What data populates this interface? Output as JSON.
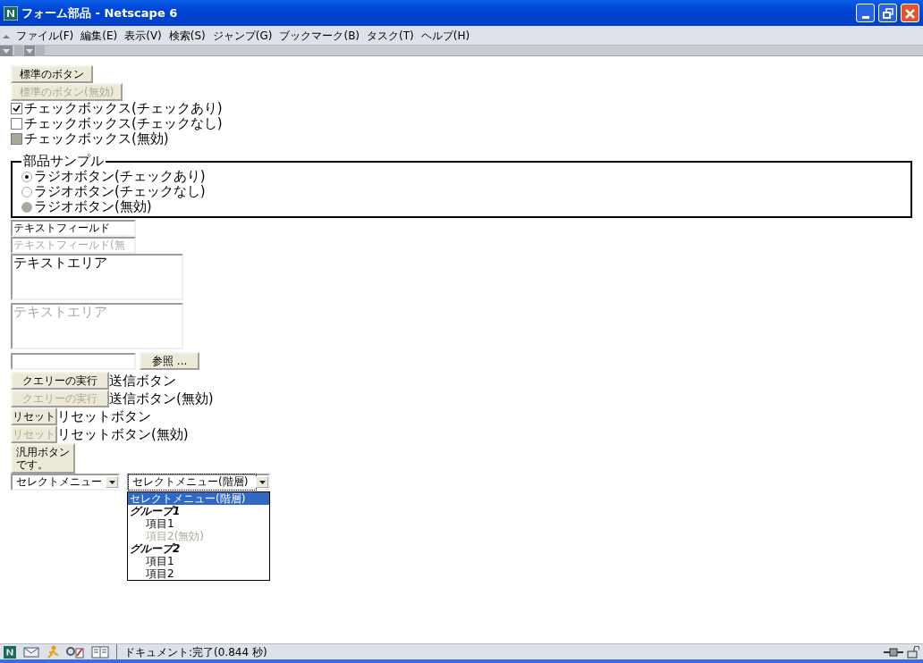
{
  "window": {
    "title": "フォーム部品 - Netscape 6"
  },
  "menu": [
    {
      "label": "ファイル(F)"
    },
    {
      "label": "編集(E)"
    },
    {
      "label": "表示(V)"
    },
    {
      "label": "検索(S)"
    },
    {
      "label": "ジャンプ(G)"
    },
    {
      "label": "ブックマーク(B)"
    },
    {
      "label": "タスク(T)"
    },
    {
      "label": "ヘルプ(H)"
    }
  ],
  "buttons": [
    {
      "label": "標準のボタン",
      "disabled": false
    },
    {
      "label": "標準のボタン(無効)",
      "disabled": true
    }
  ],
  "checkboxes": [
    {
      "label": "チェックボックス(チェックあり)",
      "checked": true,
      "disabled": false
    },
    {
      "label": "チェックボックス(チェックなし)",
      "checked": false,
      "disabled": false
    },
    {
      "label": "チェックボックス(無効)",
      "checked": false,
      "disabled": true
    }
  ],
  "radio_group": {
    "legend": "部品サンプル",
    "options": [
      {
        "label": "ラジオボタン(チェックあり)",
        "selected": true,
        "disabled": false
      },
      {
        "label": "ラジオボタン(チェックなし)",
        "selected": false,
        "disabled": false
      },
      {
        "label": "ラジオボタン(無効)",
        "selected": false,
        "disabled": true
      }
    ]
  },
  "text_fields": [
    {
      "value": "テキストフィールド",
      "disabled": false
    },
    {
      "value": "テキストフィールド(無",
      "disabled": true
    }
  ],
  "text_areas": [
    {
      "value": "テキストエリア",
      "disabled": false
    },
    {
      "value": "テキストエリア",
      "disabled": true
    }
  ],
  "file_input": {
    "button": "参照 ..."
  },
  "submit_buttons": [
    {
      "button": "クエリーの実行",
      "label": "送信ボタン",
      "disabled": false
    },
    {
      "button": "クエリーの実行",
      "label": "送信ボタン(無効)",
      "disabled": true
    }
  ],
  "reset_buttons": [
    {
      "button": "リセット",
      "label": "リセットボタン",
      "disabled": false
    },
    {
      "button": "リセット",
      "label": "リセットボタン(無効)",
      "disabled": true
    }
  ],
  "generic_button": {
    "lines": [
      "汎用ボタン",
      "です。"
    ]
  },
  "selects": [
    {
      "value": "セレクトメニュー",
      "expanded": false
    },
    {
      "value": "セレクトメニュー(階層)",
      "expanded": true,
      "options": [
        {
          "kind": "option",
          "label": "セレクトメニュー(階層)",
          "selected": true,
          "disabled": false
        },
        {
          "kind": "group",
          "label": "グループ1",
          "children": [
            {
              "kind": "option",
              "label": "項目1",
              "selected": false,
              "disabled": false
            },
            {
              "kind": "option",
              "label": "項目2(無効)",
              "selected": false,
              "disabled": true
            }
          ]
        },
        {
          "kind": "group",
          "label": "グループ2",
          "children": [
            {
              "kind": "option",
              "label": "項目1",
              "selected": false,
              "disabled": false
            },
            {
              "kind": "option",
              "label": "項目2",
              "selected": false,
              "disabled": false
            }
          ]
        }
      ]
    }
  ],
  "status_bar": {
    "text": "ドキュメント:完了(0.844 秒)"
  }
}
